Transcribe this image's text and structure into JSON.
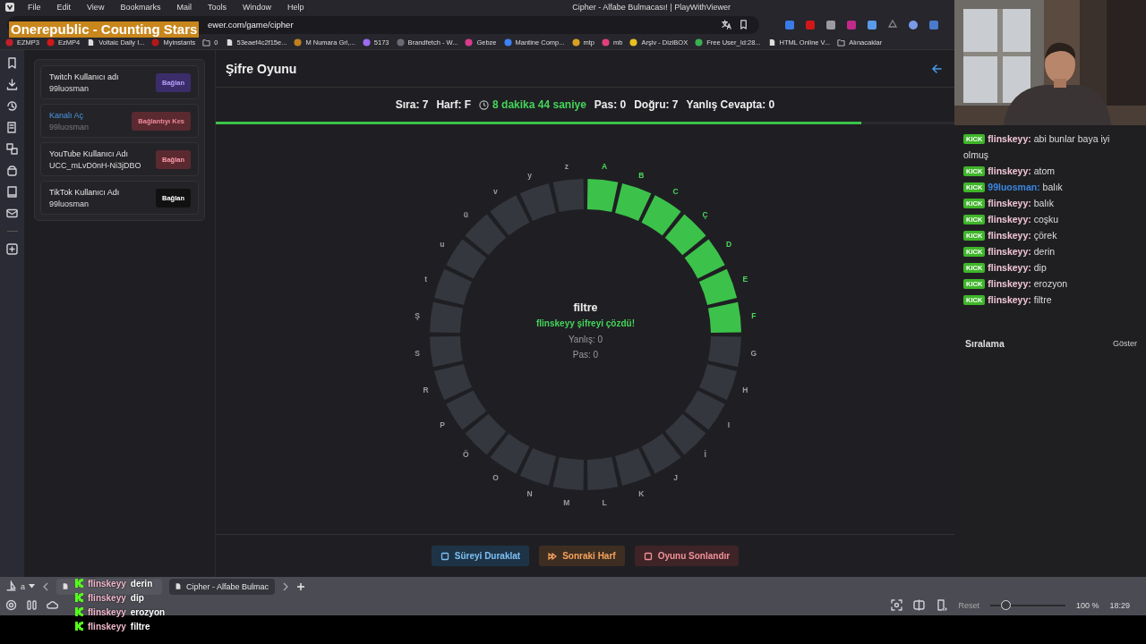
{
  "menu_bar": {
    "items": [
      "File",
      "Edit",
      "View",
      "Bookmarks",
      "Mail",
      "Tools",
      "Window",
      "Help"
    ],
    "title": "Cipher - Alfabe Bulmacası! | PlayWithViewer"
  },
  "address_bar": {
    "url": "ewer.com/game/cipher"
  },
  "now_playing": "Onerepublic - Counting Stars",
  "bookmarks": [
    {
      "kind": "site",
      "color": "#c0202a",
      "label": "EZMP3"
    },
    {
      "kind": "site",
      "color": "#d01818",
      "label": "EzMP4"
    },
    {
      "kind": "page",
      "label": "Voltaic Daily I..."
    },
    {
      "kind": "site",
      "color": "#b01818",
      "label": "Myinstants"
    },
    {
      "kind": "folder",
      "label": "0"
    },
    {
      "kind": "page",
      "label": "53eaef4c2f15e..."
    },
    {
      "kind": "site",
      "color": "#c08020",
      "label": "M Numara Gri,..."
    },
    {
      "kind": "site",
      "color": "#9a6cf0",
      "label": "5173"
    },
    {
      "kind": "site",
      "color": "#6a6a74",
      "label": "Brandfetch - W..."
    },
    {
      "kind": "site",
      "color": "#d83c8c",
      "label": "Gebze"
    },
    {
      "kind": "site",
      "color": "#3b82f6",
      "label": "Mantine Comp..."
    },
    {
      "kind": "site",
      "color": "#d8a020",
      "label": "mtp"
    },
    {
      "kind": "site",
      "color": "#e0407a",
      "label": "mb"
    },
    {
      "kind": "site",
      "color": "#e8c020",
      "label": "Arşiv - DiziBOX"
    },
    {
      "kind": "site",
      "color": "#3cb050",
      "label": "Free User_Id:28..."
    },
    {
      "kind": "page",
      "label": "HTML Online V..."
    },
    {
      "kind": "folder",
      "label": "Alınacaklar"
    }
  ],
  "accounts": [
    {
      "kind": "twitch",
      "label": "Twitch Kullanıcı adı",
      "value": "99luosman",
      "button": "Bağlan"
    },
    {
      "kind": "channel",
      "label": "Kanalı Aç",
      "value": "99luosman",
      "button": "Bağlantıyı Kes"
    },
    {
      "kind": "youtube",
      "label": "YouTube Kullanıcı Adı",
      "value": "UCC_mLvD0nH-Ni3jDBO",
      "button": "Bağlan"
    },
    {
      "kind": "tiktok",
      "label": "TikTok Kullanıcı Adı",
      "value": "99luosman",
      "button": "Bağlan"
    }
  ],
  "game": {
    "title": "Şifre Oyunu",
    "stats": [
      {
        "kind": "plain",
        "text": "Sıra: 7"
      },
      {
        "kind": "plain",
        "text": "Harf: F"
      },
      {
        "kind": "timer",
        "text": "8 dakika 44 saniye"
      },
      {
        "kind": "plain",
        "text": "Pas: 0"
      },
      {
        "kind": "plain",
        "text": "Doğru: 7"
      },
      {
        "kind": "plain",
        "text": "Yanlış Cevapta: 0"
      }
    ],
    "progress": {
      "level": 0.874
    },
    "ring": [
      {
        "letter": "A",
        "solved": true
      },
      {
        "letter": "B",
        "solved": true
      },
      {
        "letter": "C",
        "solved": true
      },
      {
        "letter": "Ç",
        "solved": true
      },
      {
        "letter": "D",
        "solved": true
      },
      {
        "letter": "E",
        "solved": true
      },
      {
        "letter": "F",
        "solved": true
      },
      {
        "letter": "G",
        "solved": false
      },
      {
        "letter": "H",
        "solved": false
      },
      {
        "letter": "I",
        "solved": false
      },
      {
        "letter": "İ",
        "solved": false
      },
      {
        "letter": "J",
        "solved": false
      },
      {
        "letter": "K",
        "solved": false
      },
      {
        "letter": "L",
        "solved": false
      },
      {
        "letter": "M",
        "solved": false
      },
      {
        "letter": "N",
        "solved": false
      },
      {
        "letter": "O",
        "solved": false
      },
      {
        "letter": "Ö",
        "solved": false
      },
      {
        "letter": "P",
        "solved": false
      },
      {
        "letter": "R",
        "solved": false
      },
      {
        "letter": "S",
        "solved": false
      },
      {
        "letter": "Ş",
        "solved": false
      },
      {
        "letter": "t",
        "solved": false
      },
      {
        "letter": "u",
        "solved": false
      },
      {
        "letter": "ü",
        "solved": false
      },
      {
        "letter": "v",
        "solved": false
      },
      {
        "letter": "y",
        "solved": false
      },
      {
        "letter": "z",
        "solved": false
      }
    ],
    "center": {
      "word": "filtre",
      "message": "flinskeyy şifreyi çözdü!",
      "wrong": "Yanlış: 0",
      "pass": "Pas: 0"
    },
    "buttons": [
      {
        "kind": "pause",
        "label": "Süreyi Duraklat"
      },
      {
        "kind": "next",
        "label": "Sonraki Harf"
      },
      {
        "kind": "end",
        "label": "Oyunu Sonlandır"
      }
    ]
  },
  "chat": {
    "messages": [
      {
        "badge": "KICK",
        "user": "flinskeyy:",
        "color": "#f2c6d6",
        "text": "abi bunlar baya iyi olmuş"
      },
      {
        "badge": "KICK",
        "user": "flinskeyy:",
        "color": "#f2c6d6",
        "text": "atom"
      },
      {
        "badge": "KICK",
        "user": "99luosman:",
        "color": "#3a86e0",
        "text": "balık"
      },
      {
        "badge": "KICK",
        "user": "flinskeyy:",
        "color": "#f2c6d6",
        "text": "balık"
      },
      {
        "badge": "KICK",
        "user": "flinskeyy:",
        "color": "#f2c6d6",
        "text": "coşku"
      },
      {
        "badge": "KICK",
        "user": "flinskeyy:",
        "color": "#f2c6d6",
        "text": "çörek"
      },
      {
        "badge": "KICK",
        "user": "flinskeyy:",
        "color": "#f2c6d6",
        "text": "derin"
      },
      {
        "badge": "KICK",
        "user": "flinskeyy:",
        "color": "#f2c6d6",
        "text": "dip"
      },
      {
        "badge": "KICK",
        "user": "flinskeyy:",
        "color": "#f2c6d6",
        "text": "erozyon"
      },
      {
        "badge": "KICK",
        "user": "flinskeyy:",
        "color": "#f2c6d6",
        "text": "filtre"
      }
    ],
    "ranking": "Sıralama",
    "show": "Göster"
  },
  "tab_bar": {
    "profile": "a",
    "tabs": [
      {
        "selected": false
      },
      {
        "title": "Cipher - Alfabe Bulmac",
        "selected": true
      }
    ]
  },
  "status_bar": {
    "reset": "Reset",
    "zoom": {
      "level": 0.2
    },
    "zoom_text": "100 %",
    "clock": "18:29"
  },
  "stream_overlay": [
    {
      "user": "flinskeyy",
      "text": "derin"
    },
    {
      "user": "flinskeyy",
      "text": "dip"
    },
    {
      "user": "flinskeyy",
      "text": "erozyon"
    },
    {
      "user": "flinskeyy",
      "text": "filtre"
    }
  ]
}
